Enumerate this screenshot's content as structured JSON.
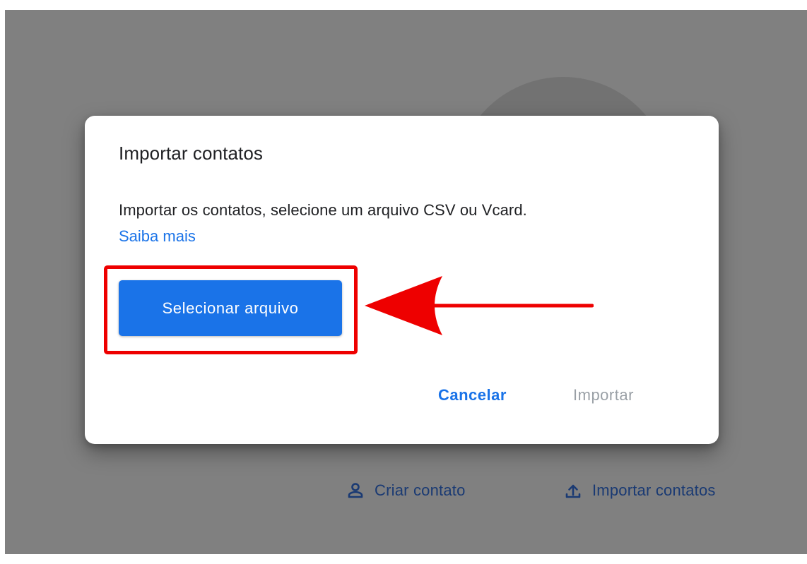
{
  "background": {
    "create_contact_label": "Criar contato",
    "create_contact_icon": "person-outline-icon",
    "import_contacts_label": "Importar contatos",
    "import_contacts_icon": "upload-icon"
  },
  "dialog": {
    "title": "Importar contatos",
    "description": "Importar os contatos, selecione um arquivo CSV ou Vcard.",
    "learn_more": "Saiba mais",
    "select_file_button": "Selecionar arquivo",
    "cancel_button": "Cancelar",
    "import_button": "Importar",
    "import_button_state": "disabled"
  },
  "annotation": {
    "highlight_color": "#ee0000",
    "arrow_color": "#ee0000",
    "target": "select_file_button"
  },
  "colors": {
    "accent": "#1a73e8",
    "overlay": "#808080",
    "disabled_text": "#9aa0a6"
  }
}
